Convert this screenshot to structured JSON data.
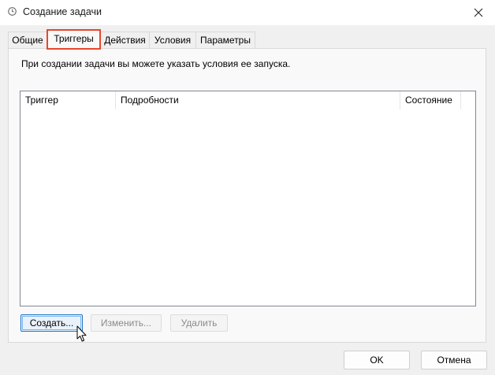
{
  "window": {
    "title": "Создание задачи",
    "icon": "clock-icon",
    "close_glyph": "✕"
  },
  "tabs": [
    {
      "label": "Общие",
      "active": false
    },
    {
      "label": "Триггеры",
      "active": true
    },
    {
      "label": "Действия",
      "active": false
    },
    {
      "label": "Условия",
      "active": false
    },
    {
      "label": "Параметры",
      "active": false
    }
  ],
  "triggers": {
    "description": "При создании задачи вы можете указать условия ее запуска.",
    "columns": [
      "Триггер",
      "Подробности",
      "Состояние"
    ],
    "rows": [],
    "buttons": {
      "create": "Создать...",
      "edit": "Изменить...",
      "delete": "Удалить"
    }
  },
  "footer": {
    "ok": "OK",
    "cancel": "Отмена"
  },
  "colors": {
    "highlight": "#e8462e",
    "focus": "#1f73c6"
  }
}
